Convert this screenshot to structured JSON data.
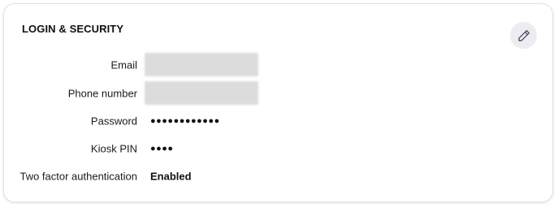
{
  "card": {
    "title": "LOGIN & SECURITY",
    "edit_icon": "pencil-icon"
  },
  "fields": [
    {
      "label": "Email",
      "value": "",
      "redacted": true
    },
    {
      "label": "Phone number",
      "value": "",
      "redacted": true
    },
    {
      "label": "Password",
      "value": "●●●●●●●●●●●●"
    },
    {
      "label": "Kiosk PIN",
      "value": "●●●●"
    },
    {
      "label": "Two factor authentication",
      "value": "Enabled"
    }
  ],
  "colors": {
    "card_border": "#e3e3e3",
    "edit_button_bg": "#ececf1",
    "redacted_fill": "#dcdcdc",
    "text": "#1a1a1a"
  }
}
